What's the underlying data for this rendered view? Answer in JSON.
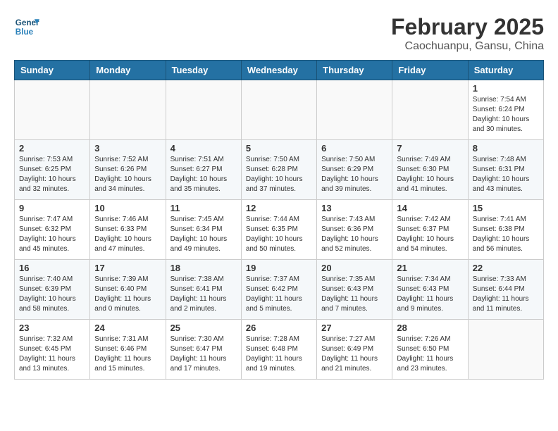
{
  "header": {
    "logo_line1": "General",
    "logo_line2": "Blue",
    "title": "February 2025",
    "subtitle": "Caochuanpu, Gansu, China"
  },
  "days_of_week": [
    "Sunday",
    "Monday",
    "Tuesday",
    "Wednesday",
    "Thursday",
    "Friday",
    "Saturday"
  ],
  "weeks": [
    [
      {
        "day": "",
        "info": ""
      },
      {
        "day": "",
        "info": ""
      },
      {
        "day": "",
        "info": ""
      },
      {
        "day": "",
        "info": ""
      },
      {
        "day": "",
        "info": ""
      },
      {
        "day": "",
        "info": ""
      },
      {
        "day": "1",
        "info": "Sunrise: 7:54 AM\nSunset: 6:24 PM\nDaylight: 10 hours and 30 minutes."
      }
    ],
    [
      {
        "day": "2",
        "info": "Sunrise: 7:53 AM\nSunset: 6:25 PM\nDaylight: 10 hours and 32 minutes."
      },
      {
        "day": "3",
        "info": "Sunrise: 7:52 AM\nSunset: 6:26 PM\nDaylight: 10 hours and 34 minutes."
      },
      {
        "day": "4",
        "info": "Sunrise: 7:51 AM\nSunset: 6:27 PM\nDaylight: 10 hours and 35 minutes."
      },
      {
        "day": "5",
        "info": "Sunrise: 7:50 AM\nSunset: 6:28 PM\nDaylight: 10 hours and 37 minutes."
      },
      {
        "day": "6",
        "info": "Sunrise: 7:50 AM\nSunset: 6:29 PM\nDaylight: 10 hours and 39 minutes."
      },
      {
        "day": "7",
        "info": "Sunrise: 7:49 AM\nSunset: 6:30 PM\nDaylight: 10 hours and 41 minutes."
      },
      {
        "day": "8",
        "info": "Sunrise: 7:48 AM\nSunset: 6:31 PM\nDaylight: 10 hours and 43 minutes."
      }
    ],
    [
      {
        "day": "9",
        "info": "Sunrise: 7:47 AM\nSunset: 6:32 PM\nDaylight: 10 hours and 45 minutes."
      },
      {
        "day": "10",
        "info": "Sunrise: 7:46 AM\nSunset: 6:33 PM\nDaylight: 10 hours and 47 minutes."
      },
      {
        "day": "11",
        "info": "Sunrise: 7:45 AM\nSunset: 6:34 PM\nDaylight: 10 hours and 49 minutes."
      },
      {
        "day": "12",
        "info": "Sunrise: 7:44 AM\nSunset: 6:35 PM\nDaylight: 10 hours and 50 minutes."
      },
      {
        "day": "13",
        "info": "Sunrise: 7:43 AM\nSunset: 6:36 PM\nDaylight: 10 hours and 52 minutes."
      },
      {
        "day": "14",
        "info": "Sunrise: 7:42 AM\nSunset: 6:37 PM\nDaylight: 10 hours and 54 minutes."
      },
      {
        "day": "15",
        "info": "Sunrise: 7:41 AM\nSunset: 6:38 PM\nDaylight: 10 hours and 56 minutes."
      }
    ],
    [
      {
        "day": "16",
        "info": "Sunrise: 7:40 AM\nSunset: 6:39 PM\nDaylight: 10 hours and 58 minutes."
      },
      {
        "day": "17",
        "info": "Sunrise: 7:39 AM\nSunset: 6:40 PM\nDaylight: 11 hours and 0 minutes."
      },
      {
        "day": "18",
        "info": "Sunrise: 7:38 AM\nSunset: 6:41 PM\nDaylight: 11 hours and 2 minutes."
      },
      {
        "day": "19",
        "info": "Sunrise: 7:37 AM\nSunset: 6:42 PM\nDaylight: 11 hours and 5 minutes."
      },
      {
        "day": "20",
        "info": "Sunrise: 7:35 AM\nSunset: 6:43 PM\nDaylight: 11 hours and 7 minutes."
      },
      {
        "day": "21",
        "info": "Sunrise: 7:34 AM\nSunset: 6:43 PM\nDaylight: 11 hours and 9 minutes."
      },
      {
        "day": "22",
        "info": "Sunrise: 7:33 AM\nSunset: 6:44 PM\nDaylight: 11 hours and 11 minutes."
      }
    ],
    [
      {
        "day": "23",
        "info": "Sunrise: 7:32 AM\nSunset: 6:45 PM\nDaylight: 11 hours and 13 minutes."
      },
      {
        "day": "24",
        "info": "Sunrise: 7:31 AM\nSunset: 6:46 PM\nDaylight: 11 hours and 15 minutes."
      },
      {
        "day": "25",
        "info": "Sunrise: 7:30 AM\nSunset: 6:47 PM\nDaylight: 11 hours and 17 minutes."
      },
      {
        "day": "26",
        "info": "Sunrise: 7:28 AM\nSunset: 6:48 PM\nDaylight: 11 hours and 19 minutes."
      },
      {
        "day": "27",
        "info": "Sunrise: 7:27 AM\nSunset: 6:49 PM\nDaylight: 11 hours and 21 minutes."
      },
      {
        "day": "28",
        "info": "Sunrise: 7:26 AM\nSunset: 6:50 PM\nDaylight: 11 hours and 23 minutes."
      },
      {
        "day": "",
        "info": ""
      }
    ]
  ]
}
